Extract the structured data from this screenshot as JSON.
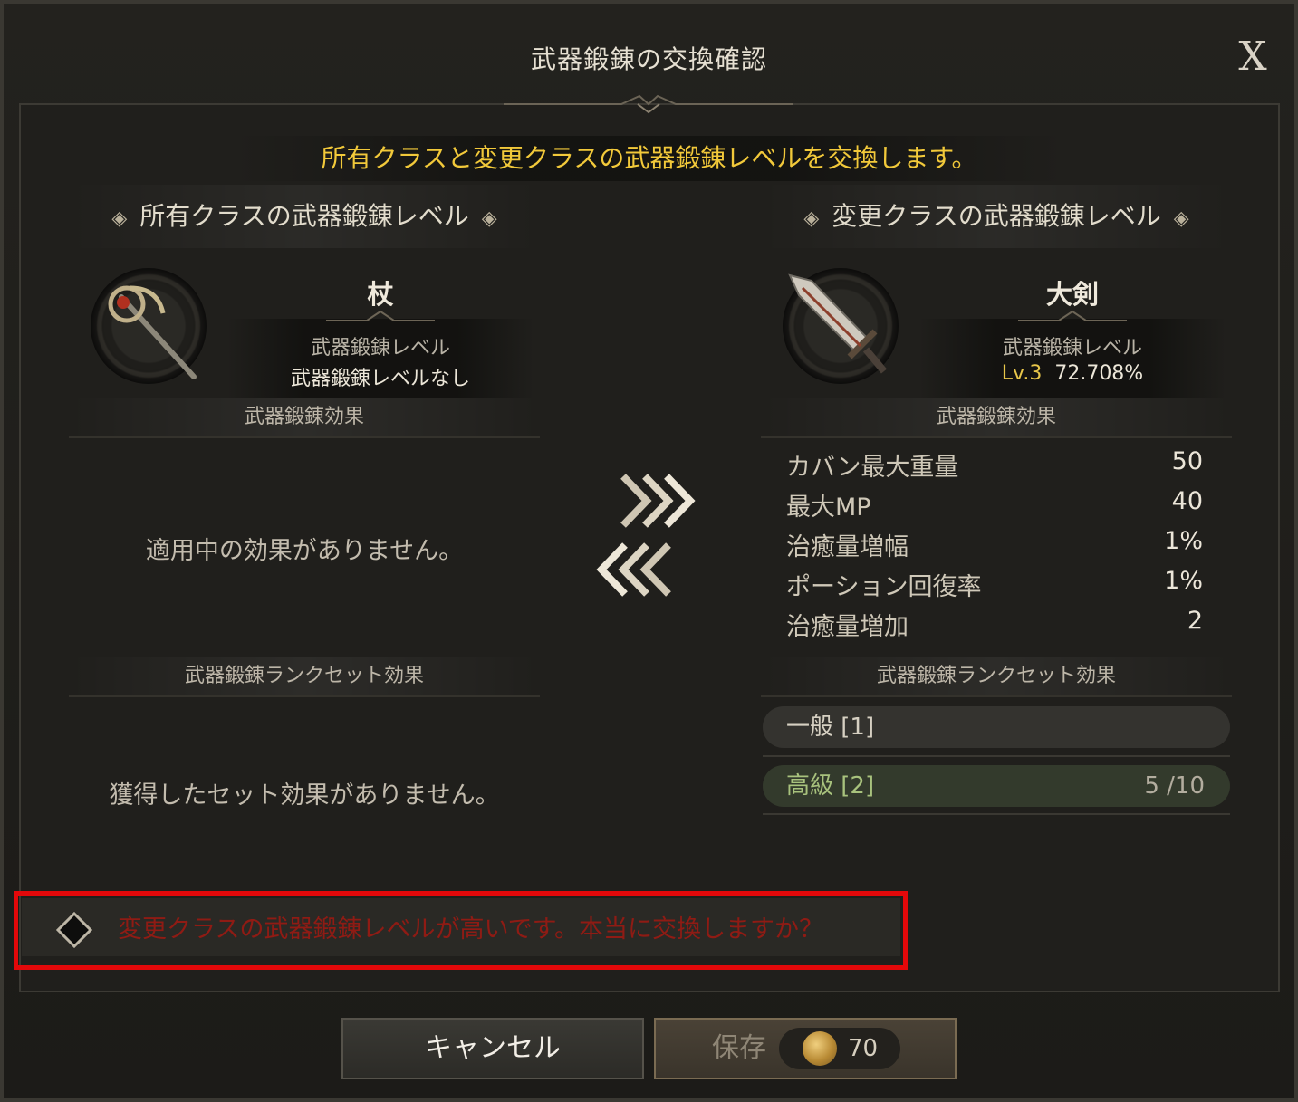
{
  "dialog": {
    "title": "武器鍛錬の交換確認",
    "close_label": "X",
    "banner": "所有クラスと変更クラスの武器鍛錬レベルを交換します。"
  },
  "left": {
    "header": "所有クラスの武器鍛錬レベル",
    "weapon_name": "杖",
    "level_label": "武器鍛錬レベル",
    "level_value": "武器鍛錬レベルなし",
    "effects_label": "武器鍛錬効果",
    "effects_empty": "適用中の効果がありません。",
    "set_label": "武器鍛錬ランクセット効果",
    "set_empty": "獲得したセット効果がありません。"
  },
  "right": {
    "header": "変更クラスの武器鍛錬レベル",
    "weapon_name": "大剣",
    "level_label": "武器鍛錬レベル",
    "level_prefix": "Lv.3",
    "level_percent": "72.708%",
    "effects_label": "武器鍛錬効果",
    "stats": [
      {
        "name": "カバン最大重量",
        "value": "50"
      },
      {
        "name": "最大MP",
        "value": "40"
      },
      {
        "name": "治癒量増幅",
        "value": "1%"
      },
      {
        "name": "ポーション回復率",
        "value": "1%"
      },
      {
        "name": "治癒量増加",
        "value": "2"
      }
    ],
    "set_label": "武器鍛錬ランクセット効果",
    "ranks": [
      {
        "name": "一般 [1]",
        "count": ""
      },
      {
        "name": "高級 [2]",
        "count": "5 /10"
      }
    ]
  },
  "warning": "変更クラスの武器鍛錬レベルが高いです。本当に交換しますか？",
  "buttons": {
    "cancel": "キャンセル",
    "save": "保存",
    "save_cost": "70"
  },
  "colors": {
    "banner": "#f2c93a",
    "warning_text": "#8f1b14",
    "highlight_box": "#e3080a",
    "level_gold": "#e8c64a"
  }
}
